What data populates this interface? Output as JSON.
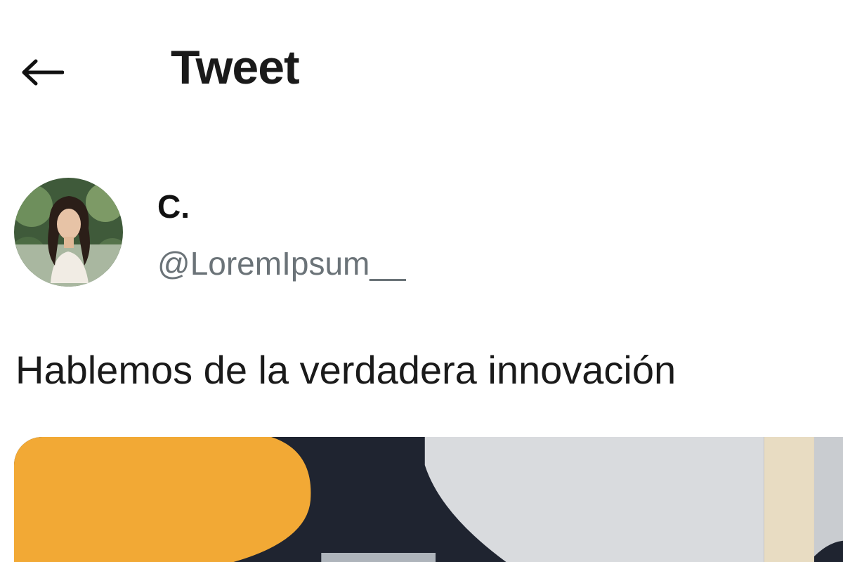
{
  "header": {
    "back_icon": "arrow-left-icon",
    "title": "Tweet"
  },
  "author": {
    "display_name": "C.",
    "handle": "@LoremIpsum__"
  },
  "tweet": {
    "text": "Hablemos de la verdadera innovación"
  },
  "colors": {
    "text_primary": "#0f1419",
    "text_secondary": "#6b7378",
    "background": "#ffffff",
    "media_orange": "#f2a935",
    "media_dark": "#1f2430",
    "media_grey": "#d9dbde"
  }
}
